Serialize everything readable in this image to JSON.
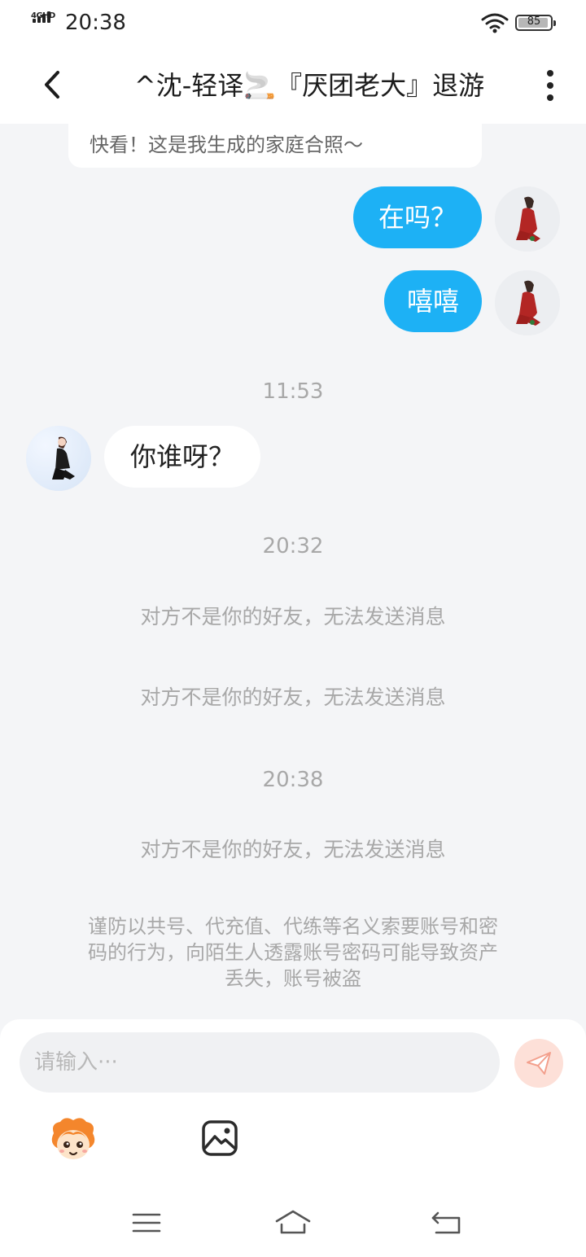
{
  "status_bar": {
    "network": "4GHD",
    "time": "20:38",
    "battery": "85",
    "battery_level": 0.85
  },
  "header": {
    "title": "^沈-轻译🚬『厌团老大』退游"
  },
  "messages": {
    "card_text": "快看！这是我生成的家庭合照～",
    "out_1": "在吗？",
    "out_2": "嘻嘻",
    "time_1": "11:53",
    "in_1": "你谁呀？",
    "time_2": "20:32",
    "notice_1": "对方不是你的好友，无法发送消息",
    "notice_2": "对方不是你的好友，无法发送消息",
    "time_3": "20:38",
    "notice_3": "对方不是你的好友，无法发送消息",
    "warning_line1": "谨防以共号、代充值、代练等名义索要账号和密",
    "warning_line2": "码的行为，向陌生人透露账号密码可能导致资产",
    "warning_line3": "丢失，账号被盗"
  },
  "input": {
    "placeholder": "请输入···"
  },
  "colors": {
    "accent_blue": "#1db1f5",
    "send_bg": "#fde0d8",
    "send_icon": "#f3a08d",
    "background": "#f4f5f7",
    "muted_text": "#a8a8a8"
  },
  "icons": {
    "back": "chevron-left-icon",
    "more": "more-vertical-icon",
    "send": "paper-plane-icon",
    "emoji": "mascot-emoji-icon",
    "image": "image-icon",
    "nav_menu": "menu-icon",
    "nav_home": "home-icon",
    "nav_back": "return-icon"
  }
}
